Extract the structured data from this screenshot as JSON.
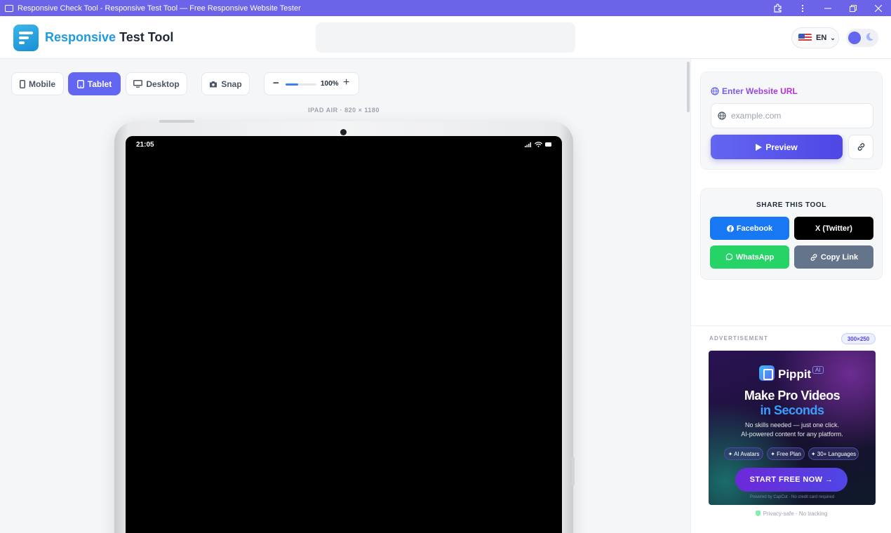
{
  "window": {
    "title": "Responsive Check Tool - Responsive Test Tool — Free Responsive Website Tester",
    "icons": [
      "monitor-icon",
      "extension-icon",
      "more-icon",
      "minimize-icon",
      "maximize-icon",
      "close-icon"
    ]
  },
  "header": {
    "brand_accent": "Responsive",
    "brand_rest": "Test Tool",
    "language": "EN",
    "brand_color": "#1e9be0",
    "accent_color": "#6366f1"
  },
  "toolbar": {
    "mobile": "Mobile",
    "tablet": "Tablet",
    "desktop": "Desktop",
    "snap": "Snap",
    "zoom_label": "100%",
    "zoom_level": 0.4,
    "active_device": "tablet"
  },
  "device": {
    "label": "IPAD AIR · 820 × 1180",
    "time": "21:05"
  },
  "url_panel": {
    "title": "Enter Website URL",
    "placeholder": "example.com",
    "preview": "Preview"
  },
  "share": {
    "title": "SHARE THIS TOOL",
    "facebook": "Facebook",
    "twitter": "X (Twitter)",
    "whatsapp": "WhatsApp",
    "copy": "Copy Link",
    "colors": {
      "facebook": "#1877f2",
      "twitter": "#000000",
      "whatsapp": "#25d366",
      "copy": "#64748b"
    }
  },
  "ad": {
    "label": "ADVERTISEMENT",
    "size": "300×250",
    "brand": "Pippit",
    "ai_tag": "AI",
    "headline1": "Make Pro Videos",
    "headline2": "in Seconds",
    "line1": "No skills needed — just one click.",
    "line2": "AI-powered content for any platform.",
    "chips": [
      "✦ AI Avatars",
      "✦ Free Plan",
      "✦ 30+ Languages"
    ],
    "cta": "START FREE NOW →",
    "footer": "Powered by CapCut · No credit card required",
    "privacy": "Privacy-safe · No tracking"
  }
}
